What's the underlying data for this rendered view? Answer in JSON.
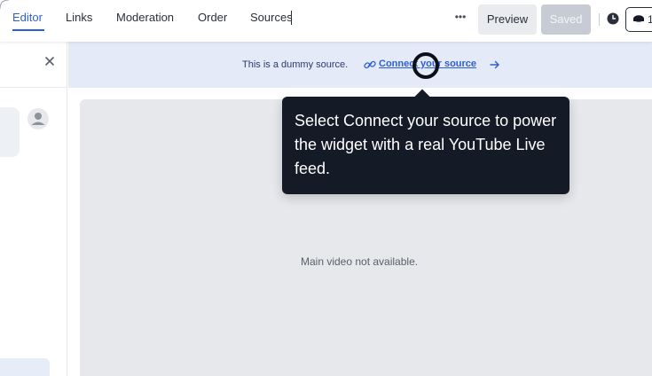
{
  "tabs": [
    {
      "label": "Editor",
      "active": true
    },
    {
      "label": "Links"
    },
    {
      "label": "Moderation"
    },
    {
      "label": "Order"
    },
    {
      "label": "Sources"
    }
  ],
  "toolbar": {
    "more_label": "•••",
    "preview_label": "Preview",
    "saved_label": "Saved",
    "chip_text": "1"
  },
  "banner": {
    "text": "This is a dummy source.",
    "link_label": "Connect your source"
  },
  "main": {
    "video_message": "Main video not available."
  },
  "tooltip": {
    "text": "Select Connect your source to power the widget with a real YouTube Live feed."
  },
  "colors": {
    "accent": "#2c5fd6",
    "banner_bg": "#e5eaf8",
    "tooltip_bg": "#141a26",
    "video_bg": "#e6e8ec"
  },
  "icons": [
    "close-icon",
    "user-icon",
    "link-icon",
    "arrow-right-icon",
    "clock-icon",
    "coin-icon"
  ]
}
